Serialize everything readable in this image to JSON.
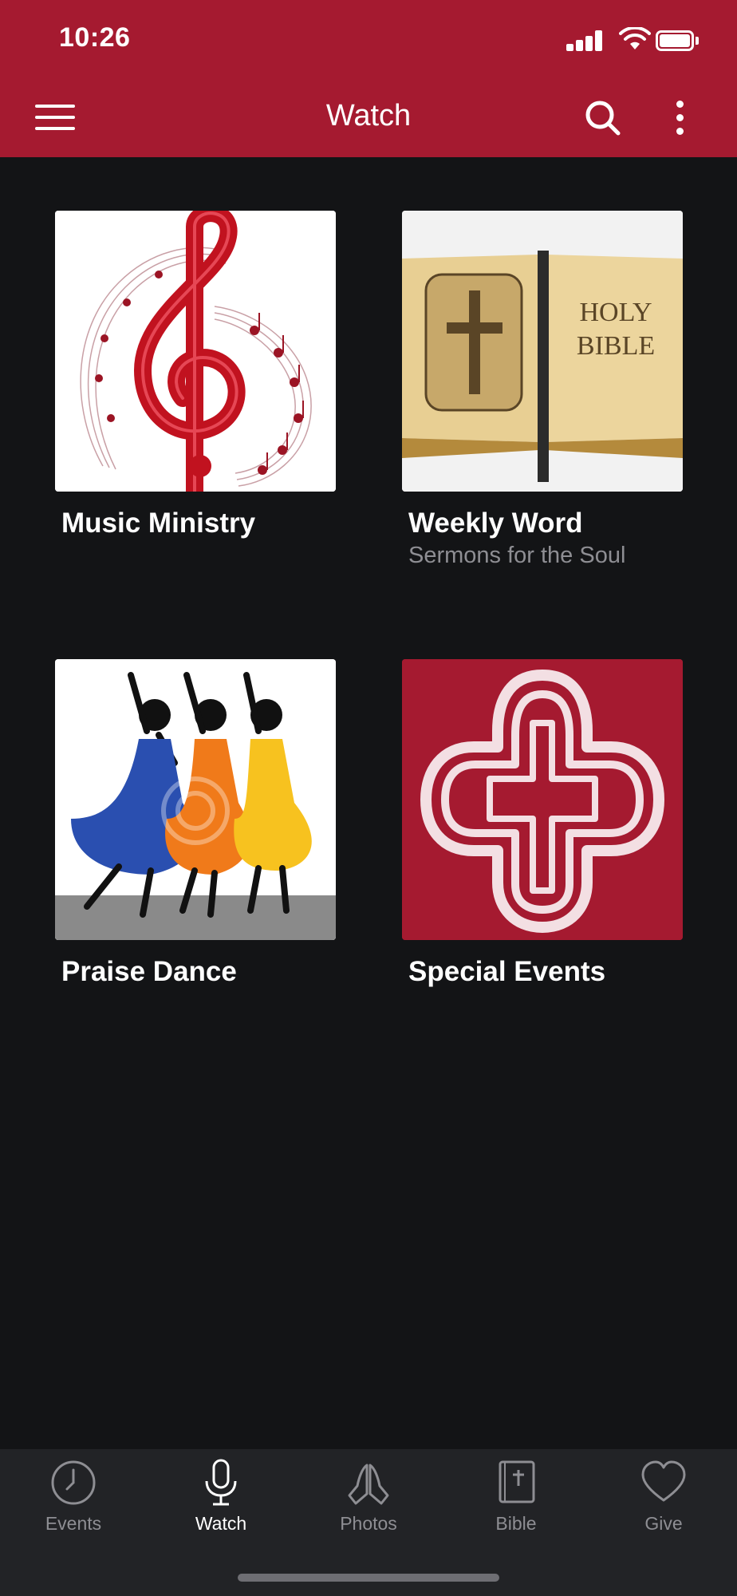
{
  "status_bar": {
    "time": "10:26"
  },
  "header": {
    "title": "Watch",
    "background": "#a51a30",
    "icons": {
      "menu": "hamburger-menu-icon",
      "search": "search-icon",
      "more": "more-vertical-icon"
    }
  },
  "tiles": [
    {
      "title": "Music Ministry",
      "subtitle": "",
      "image": "treble-clef-music-notes"
    },
    {
      "title": "Weekly Word",
      "subtitle": "Sermons for the Soul",
      "image": "holy-bible-book",
      "image_text": [
        "HOLY",
        "BIBLE"
      ]
    },
    {
      "title": "Praise Dance",
      "subtitle": "",
      "image": "praise-dancers"
    },
    {
      "title": "Special Events",
      "subtitle": "",
      "image": "interlaced-cross"
    }
  ],
  "tabbar": {
    "active": "Watch",
    "items": [
      {
        "label": "Events",
        "icon": "clock-icon"
      },
      {
        "label": "Watch",
        "icon": "microphone-icon"
      },
      {
        "label": "Photos",
        "icon": "praying-hands-icon"
      },
      {
        "label": "Bible",
        "icon": "bible-book-icon"
      },
      {
        "label": "Give",
        "icon": "heart-icon"
      }
    ]
  }
}
